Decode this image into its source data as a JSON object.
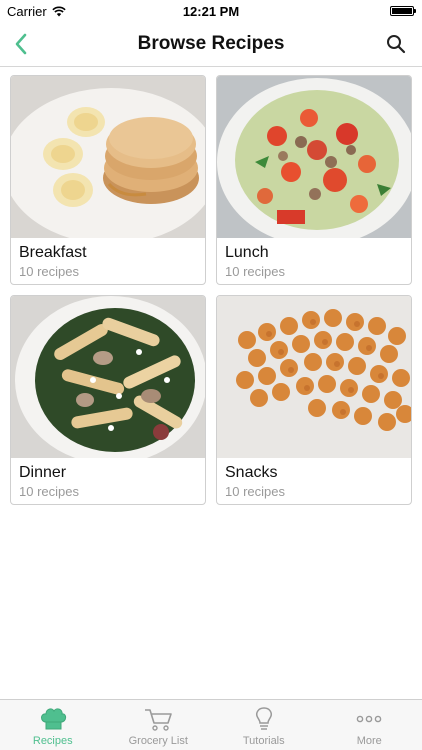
{
  "status_bar": {
    "carrier": "Carrier",
    "time": "12:21 PM"
  },
  "nav": {
    "title": "Browse Recipes",
    "back_icon": "chevron-left-icon",
    "search_icon": "search-icon"
  },
  "categories": [
    {
      "name": "Breakfast",
      "count": "10 recipes"
    },
    {
      "name": "Lunch",
      "count": "10 recipes"
    },
    {
      "name": "Dinner",
      "count": "10 recipes"
    },
    {
      "name": "Snacks",
      "count": "10 recipes"
    }
  ],
  "tabs": [
    {
      "label": "Recipes",
      "icon": "chef-hat-icon",
      "active": true
    },
    {
      "label": "Grocery List",
      "icon": "cart-icon",
      "active": false
    },
    {
      "label": "Tutorials",
      "icon": "lightbulb-icon",
      "active": false
    },
    {
      "label": "More",
      "icon": "more-icon",
      "active": false
    }
  ],
  "colors": {
    "accent": "#4fbf8f",
    "inactive": "#9a9a9a"
  }
}
